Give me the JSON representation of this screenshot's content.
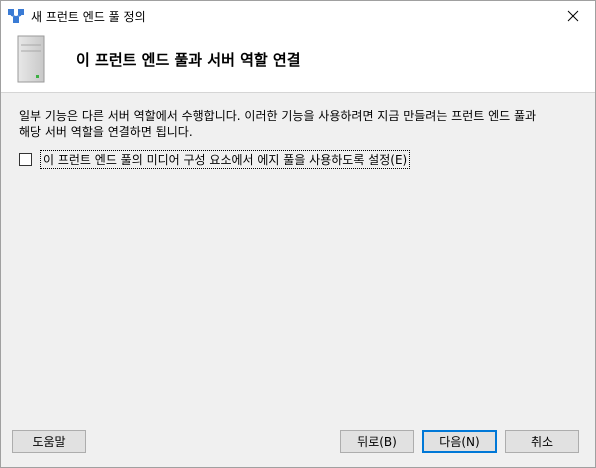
{
  "window": {
    "title": "새 프런트 엔드 풀 정의"
  },
  "header": {
    "title": "이 프런트 엔드 풀과 서버 역할 연결"
  },
  "body": {
    "line1": "일부 기능은 다른 서버 역할에서 수행합니다. 이러한 기능을 사용하려면 지금 만들려는 프런트 엔드 풀과",
    "line2": "해당 서버 역할을 연결하면 됩니다.",
    "checkbox_label": "이 프런트 엔드 풀의 미디어 구성 요소에서 에지 풀을 사용하도록 설정(E)",
    "checkbox_checked": false
  },
  "buttons": {
    "help": "도움말",
    "back": "뒤로(B)",
    "next": "다음(N)",
    "cancel": "취소"
  },
  "icons": {
    "app": "wizard-network-icon",
    "server": "server-icon",
    "close": "close-icon"
  }
}
